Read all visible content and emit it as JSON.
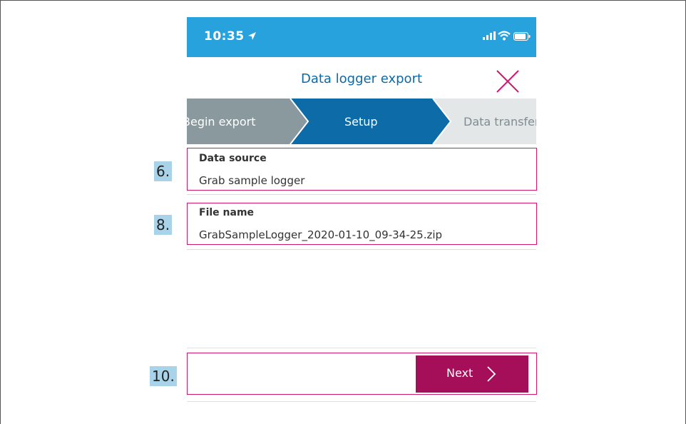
{
  "status_bar": {
    "time": "10:35",
    "location_icon": "location-arrow-icon",
    "signal_icon": "cellular-signal-icon",
    "wifi_icon": "wifi-icon",
    "battery_icon": "battery-icon",
    "color": "#27a2dd"
  },
  "header": {
    "title": "Data logger export",
    "close_icon": "close-icon",
    "title_color": "#0a69a6",
    "close_color": "#d1186f"
  },
  "steps": {
    "items": [
      {
        "label": "Begin export",
        "state": "completed",
        "color": "#8a999e"
      },
      {
        "label": "Setup",
        "state": "active",
        "color": "#0d6ca8"
      },
      {
        "label": "Data transfer",
        "state": "upcoming",
        "color": "#e3e7e8"
      }
    ]
  },
  "form": {
    "data_source": {
      "label": "Data source",
      "value": "Grab sample logger"
    },
    "file_name": {
      "label": "File name",
      "value": "GrabSampleLogger_2020-01-10_09-34-25.zip"
    }
  },
  "footer": {
    "next_label": "Next",
    "next_icon": "chevron-right-icon",
    "button_color": "#a50f5a"
  },
  "annotations": {
    "markers": [
      "6.",
      "8.",
      "10."
    ],
    "highlight_color": "#d1186f",
    "marker_color": "#a9d3e8"
  }
}
